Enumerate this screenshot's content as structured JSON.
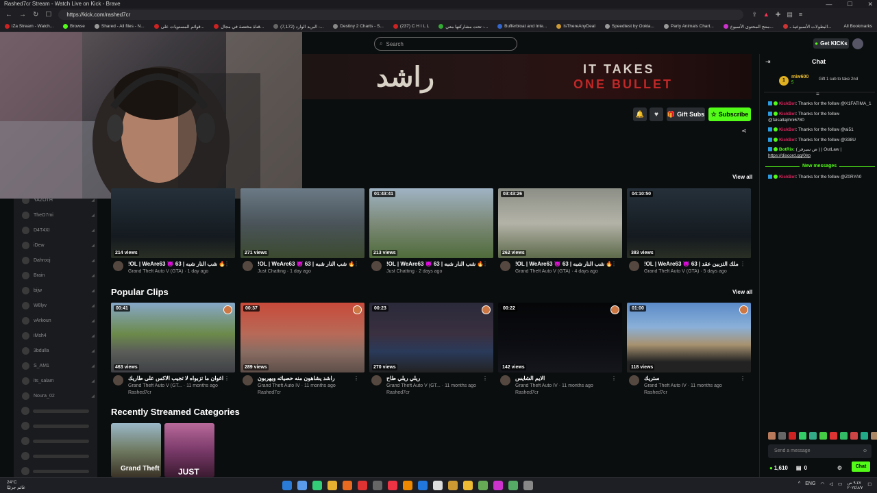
{
  "browser": {
    "window_title": "Rashed7cr Stream - Watch Live on Kick - Brave",
    "url": "https://kick.com/rashed7cr",
    "bookmarks": [
      "iZa Stream - Watch...",
      "Browse",
      "Shared - All files - N...",
      "قوائم المستويات على...",
      "قناة مختصة في مجال...",
      "(7,172) البريد الوارد -...",
      "Destiny 2 Charts - S...",
      "(237) C H I L L",
      "تحت مشاركتها معي -...",
      "Bufferbloat and Inte...",
      "IsThereAnyDeal",
      "Speedtest by Ookla...",
      "Party Animals Chart...",
      "منتج المحتوى الأسبوع...",
      "البطولات الأسبوعية ـ..."
    ],
    "all_bookmarks": "All Bookmarks"
  },
  "header": {
    "search_placeholder": "Search",
    "get_kicks": "Get KICKs"
  },
  "banner": {
    "logo_text": "راشد",
    "slogan_line1": "IT TAKES",
    "slogan_line2": "ONE BULLET"
  },
  "channel_actions": {
    "gift_subs": "Gift Subs",
    "subscribe": "Subscribe"
  },
  "left_nav": {
    "channels": [
      "YAZOTH",
      "TheO7mi",
      "D4T4XI",
      "iDew",
      "Dahrooj",
      "Brain",
      "bijw",
      "W8lyv",
      "vArkoun",
      "iMsh4",
      "3bdulla",
      "S_AM1",
      "its_salam",
      "Noura_02"
    ]
  },
  "vods": {
    "view_all": "View all",
    "items": [
      {
        "duration": "",
        "views": "214 views",
        "title": "!OL | WeAre63 😈 63 | شب النار شبه 🔥",
        "category": "Grand Theft Auto V (GTA)",
        "age": "1 day ago"
      },
      {
        "duration": "",
        "views": "271 views",
        "title": "!OL | WeAre63 😈 63 | شب النار شبه 🔥",
        "category": "Just Chatting",
        "age": "1 day ago"
      },
      {
        "duration": "01:43:41",
        "views": "213 views",
        "title": "!OL | WeAre63 😈 63 | شب النار شبه 🔥",
        "category": "Just Chatting",
        "age": "2 days ago"
      },
      {
        "duration": "03:43:26",
        "views": "262 views",
        "title": "!OL | WeAre63 😈 63 | شب النار شبه 🔥",
        "category": "Grand Theft Auto V (GTA)",
        "age": "4 days ago"
      },
      {
        "duration": "04:10:50",
        "views": "383 views",
        "title": "!OL | WeAre63 😈 63 | ملك التزبين عقد",
        "category": "Grand Theft Auto V (GTA)",
        "age": "5 days ago"
      }
    ]
  },
  "clips": {
    "title": "Popular Clips",
    "view_all": "View all",
    "items": [
      {
        "duration": "00:41",
        "views": "463 views",
        "title": "اغوان ما تزبواه لا تجيب الاكس على طاريك",
        "category": "Grand Theft Auto V (GT...",
        "age": "11 months ago",
        "channel": "Rashed7cr"
      },
      {
        "duration": "00:37",
        "views": "289 views",
        "title": "راشد يشاهون منه حصياته ويهربون",
        "category": "Grand Theft Auto IV",
        "age": "11 months ago",
        "channel": "Rashed7cr"
      },
      {
        "duration": "00:23",
        "views": "270 views",
        "title": "ريلي ريلي طاح",
        "category": "Grand Theft Auto V (GT...",
        "age": "11 months ago",
        "channel": "Rashed7cr"
      },
      {
        "duration": "00:22",
        "views": "142 views",
        "title": "الايم الشايس",
        "category": "Grand Theft Auto IV",
        "age": "11 months ago",
        "channel": "Rashed7cr"
      },
      {
        "duration": "01:00",
        "views": "118 views",
        "title": "ستريك",
        "category": "Grand Theft Auto IV",
        "age": "11 months ago",
        "channel": "Rashed7cr"
      }
    ]
  },
  "categories": {
    "title": "Recently Streamed Categories",
    "items": [
      {
        "label": "Grand Theft"
      },
      {
        "label": "JUST"
      }
    ]
  },
  "chat": {
    "title": "Chat",
    "pinned_user": "miw600",
    "pinned_count": "5",
    "pinned_rank": "1",
    "pinned_text": "Gift 1 sub to take 2nd",
    "messages": [
      {
        "user": "KickBot",
        "text": ": Thanks for the follow @X1FATIMA_1"
      },
      {
        "user": "KickBot",
        "text": ": Thanks for the follow @faisallajihni6780"
      },
      {
        "user": "KickBot",
        "text": ": Thanks for the follow @ai51"
      },
      {
        "user": "KickBot",
        "text": ": Thanks for the follow @338U"
      },
      {
        "user": "BotRix",
        "text": ": ( ض سيرفر ) | OutLaw |",
        "link": "https://discord.gg/0lrp"
      },
      {
        "user": "KickBot",
        "text": ": Thanks for the follow @Z0RYA0"
      }
    ],
    "new_messages": "New messages",
    "input_placeholder": "Send a message",
    "kicks_count": "1,610",
    "subs_count": "0",
    "send_label": "Chat"
  },
  "taskbar": {
    "temp": "24°C",
    "weather": "غائم جزئيًا",
    "lang": "ENG",
    "time": "٩:٤٧ ص",
    "date": "٢٠٢٤/٨/٧"
  },
  "colors": {
    "accent": "#53fc18",
    "bot": "#e0245e",
    "panel": "#191b1f",
    "bg": "#0b0e0f"
  }
}
